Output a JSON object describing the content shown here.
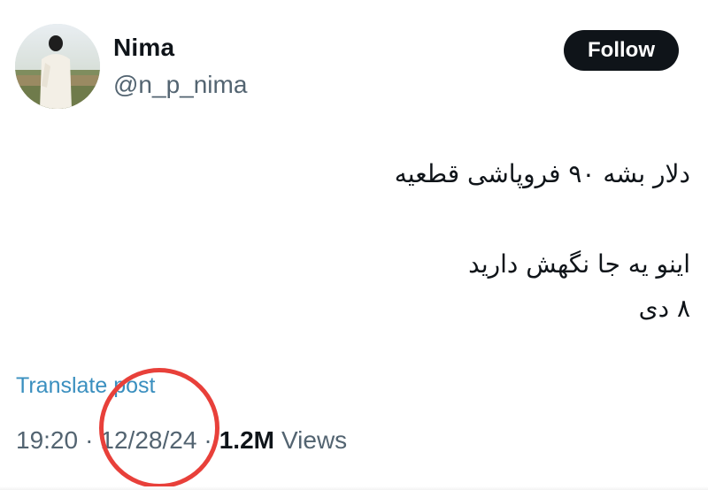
{
  "author": {
    "display_name": "Nima",
    "handle": "@n_p_nima"
  },
  "follow_button": {
    "label": "Follow"
  },
  "post": {
    "lines": [
      "دلار بشه ۹۰ فروپاشی قطعیه",
      "اینو یه جا نگهش دارید",
      "۸ دی"
    ]
  },
  "translate": {
    "label": "Translate post"
  },
  "meta": {
    "time": "19:20",
    "date": "12/28/24",
    "separator": "·",
    "views_count": "1.2M",
    "views_label": "Views"
  },
  "colors": {
    "text": "#0f1419",
    "secondary": "#536471",
    "link": "#3a8fbf",
    "button_bg": "#0f1419",
    "annotation": "#e8403a"
  }
}
